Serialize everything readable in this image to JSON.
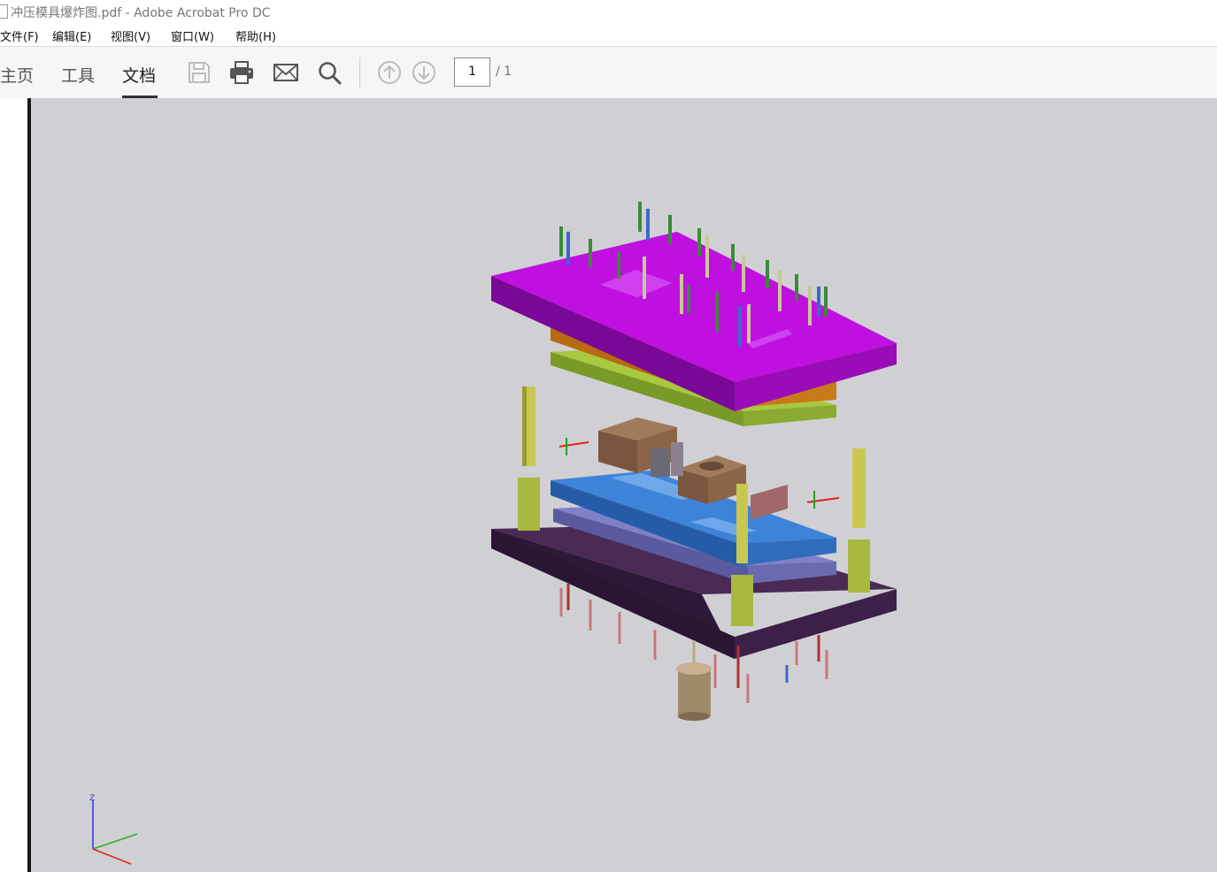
{
  "window": {
    "title": "冲压模具爆炸图.pdf - Adobe Acrobat Pro DC"
  },
  "menu": [
    "文件(F)",
    "编辑(E)",
    "视图(V)",
    "窗口(W)",
    "帮助(H)"
  ],
  "tabs": [
    {
      "label": "主页"
    },
    {
      "label": "工具"
    },
    {
      "label": "文档",
      "active": true
    }
  ],
  "tools": [
    "save-icon",
    "print-icon",
    "email-icon",
    "search-icon",
    "page-up-icon",
    "page-down-icon"
  ],
  "page_nav": {
    "current": "1",
    "total": "/ 1"
  },
  "axis_triad": {
    "z_label": "Z"
  },
  "colors": {
    "viewport_bg": "#d0d0d4",
    "top_plate": "#b000d0",
    "die_plate": "#3a7acc",
    "bottom_plate": "#3a1f45",
    "guide_post": "#b8b830"
  }
}
